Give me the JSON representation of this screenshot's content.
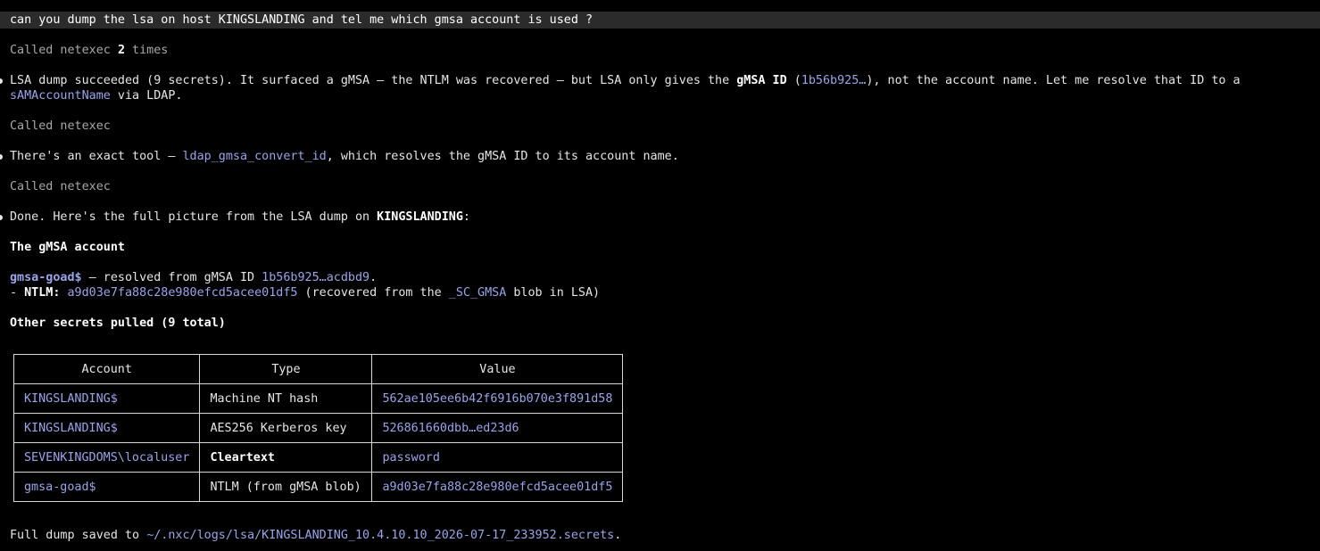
{
  "prompt": "can you dump the lsa on host KINGSLANDING and tel me which gmsa account is used ?",
  "call1": {
    "prefix": "Called netexec ",
    "count": "2",
    "suffix": " times"
  },
  "para1": {
    "a": "LSA dump succeeded (9 secrets). It surfaced a gMSA — the NTLM was recovered — but LSA only gives the ",
    "b": "gMSA ID",
    "c": " (",
    "d": "1b56b925…",
    "e": "), not the account name. Let me resolve that ID to a",
    "f": "sAMAccountName",
    "g": " via LDAP."
  },
  "call2": "Called netexec",
  "para2": {
    "a": "There's an exact tool — ",
    "b": "ldap_gmsa_convert_id",
    "c": ", which resolves the gMSA ID to its account name."
  },
  "call3": "Called netexec",
  "para3": {
    "a": "Done. Here's the full picture from the LSA dump on ",
    "b": "KINGSLANDING",
    "c": ":"
  },
  "heading1": "The gMSA account",
  "gmsa": {
    "name": "gmsa-goad$",
    "mid": " — resolved from gMSA ID ",
    "id": "1b56b925…acdbd9",
    "end": "."
  },
  "ntlm": {
    "dash": "- ",
    "label": "NTLM:",
    "space": " ",
    "hash": "a9d03e7fa88c28e980efcd5acee01df5",
    "mid": " (recovered from the ",
    "blob": "_SC_GMSA",
    "end": " blob in LSA)"
  },
  "heading2": "Other secrets pulled (9 total)",
  "table": {
    "headers": [
      "Account",
      "Type",
      "Value"
    ],
    "rows": [
      {
        "account": "KINGSLANDING$",
        "type": "Machine NT hash",
        "value": "562ae105ee6b42f6916b070e3f891d58"
      },
      {
        "account": "KINGSLANDING$",
        "type": "AES256 Kerberos key",
        "value": "526861660dbb…ed23d6"
      },
      {
        "account": "SEVENKINGDOMS\\localuser",
        "type": "Cleartext",
        "value": "password"
      },
      {
        "account": "gmsa-goad$",
        "type": "NTLM (from gMSA blob)",
        "value": "a9d03e7fa88c28e980efcd5acee01df5"
      }
    ]
  },
  "footer": {
    "prefix": "Full dump saved to ",
    "path": "~/.nxc/logs/lsa/KINGSLANDING_10.4.10.10_2026-07-17_233952.secrets",
    "end": "."
  },
  "colors": {
    "background": "#000000",
    "text": "#e6e6e6",
    "dim": "#a8a8a8",
    "code": "#9aa4e8",
    "prompt_bar": "#2b2b2b",
    "table_border": "#d8d8d8"
  }
}
